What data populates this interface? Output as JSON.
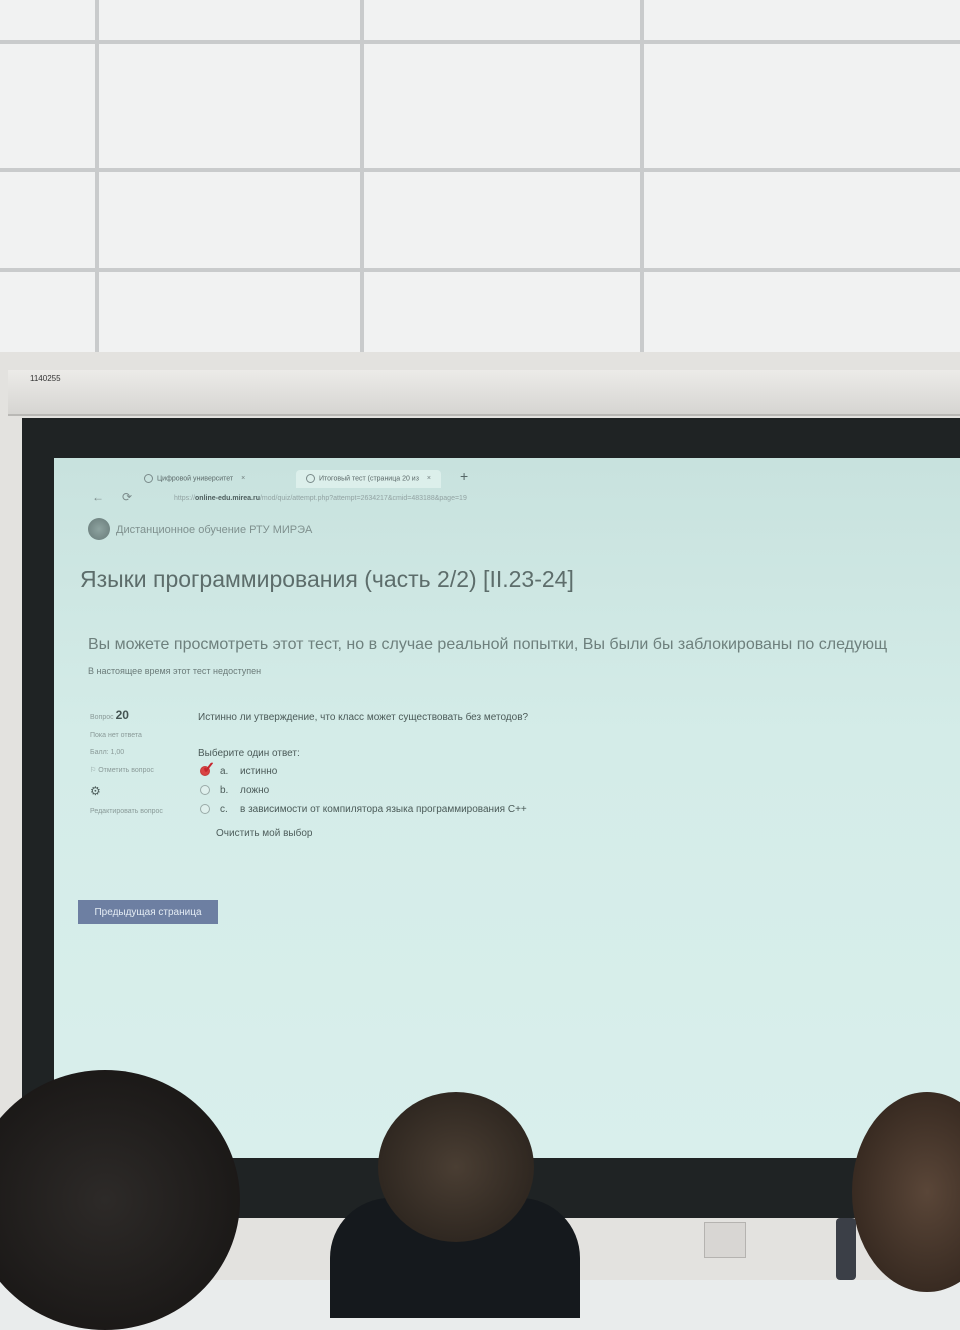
{
  "room": {
    "case_label": "1140255"
  },
  "browser": {
    "tabs": [
      {
        "label": "Цифровой университет",
        "active": false
      },
      {
        "label": "Итоговый тест (страница 20 из",
        "active": true
      }
    ],
    "tab_close": "×",
    "new_tab": "+",
    "nav": {
      "back": "←",
      "reload": "⟳"
    },
    "url_prefix": "https://",
    "url_host": "online-edu.mirea.ru",
    "url_path": "/mod/quiz/attempt.php?attempt=2634217&cmid=483188&page=19"
  },
  "site": {
    "name": "Дистанционное обучение РТУ МИРЭА"
  },
  "page": {
    "title": "Языки программирования (часть 2/2) [II.23-24]",
    "notice": "Вы можете просмотреть этот тест, но в случае реальной попытки, Вы были бы заблокированы по следующ",
    "notice_sub": "В настоящее время этот тест недоступен"
  },
  "question": {
    "label": "Вопрос",
    "number": "20",
    "state": "Пока нет ответа",
    "score": "Балл: 1,00",
    "flag_label": "Отметить вопрос",
    "edit_label": "Редактировать вопрос",
    "text": "Истинно ли утверждение, что класс может существовать без методов?",
    "prompt": "Выберите один ответ:",
    "options": [
      {
        "letter": "a.",
        "text": "истинно",
        "selected": true
      },
      {
        "letter": "b.",
        "text": "ложно",
        "selected": false
      },
      {
        "letter": "c.",
        "text": "в зависимости от компилятора языка программирования C++",
        "selected": false
      }
    ],
    "clear": "Очистить мой выбор"
  },
  "navigation": {
    "prev_button": "Предыдущая страница"
  },
  "colors": {
    "projection_bg": "#cfe8e4",
    "prev_button_bg": "#6d7fa2",
    "checkmark": "#c6262e"
  }
}
